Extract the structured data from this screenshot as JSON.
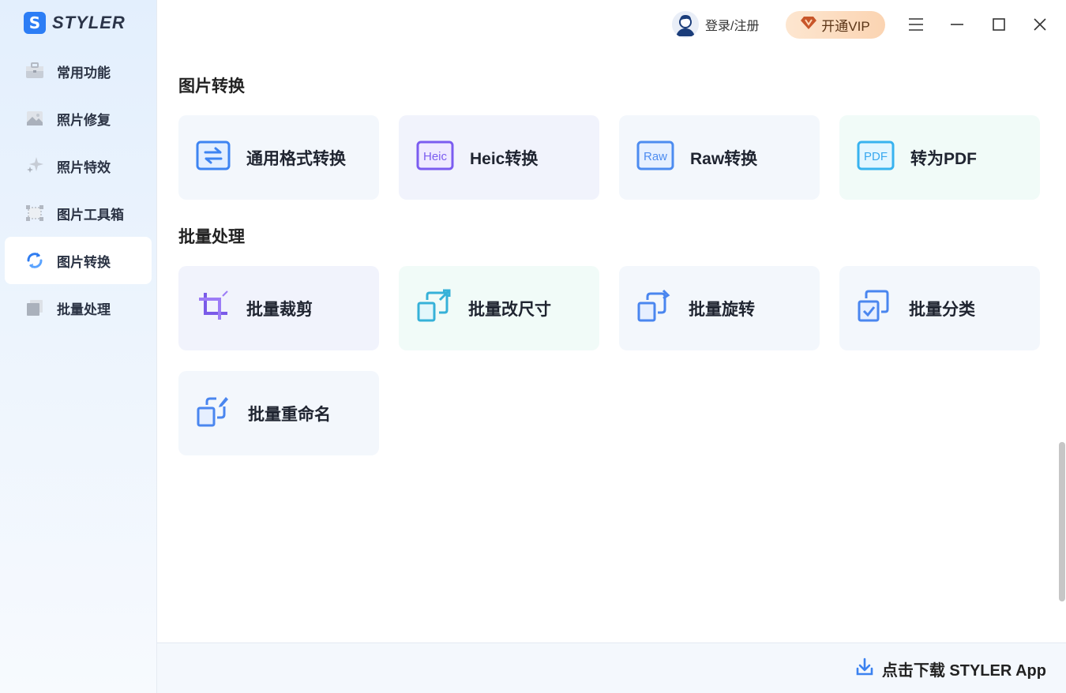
{
  "app": {
    "logo_letter": "S",
    "name": "STYLER"
  },
  "sidebar": {
    "items": [
      {
        "label": "常用功能",
        "icon": "toolbox-icon"
      },
      {
        "label": "照片修复",
        "icon": "photo-icon"
      },
      {
        "label": "照片特效",
        "icon": "sparkles-icon"
      },
      {
        "label": "图片工具箱",
        "icon": "frame-icon"
      },
      {
        "label": "图片转换",
        "icon": "convert-cycle-icon",
        "active": true
      },
      {
        "label": "批量处理",
        "icon": "stack-icon"
      }
    ]
  },
  "header": {
    "login_label": "登录/注册",
    "vip_label": "开通VIP",
    "vip_badge": "V"
  },
  "sections": {
    "convert": {
      "title": "图片转换",
      "cards": [
        {
          "label": "通用格式转换",
          "icon": "swap-arrows-icon"
        },
        {
          "label": "Heic转换",
          "icon": "heic-icon",
          "badge": "Heic"
        },
        {
          "label": "Raw转换",
          "icon": "raw-icon",
          "badge": "Raw"
        },
        {
          "label": "转为PDF",
          "icon": "pdf-icon",
          "badge": "PDF"
        }
      ]
    },
    "batch": {
      "title": "批量处理",
      "cards": [
        {
          "label": "批量裁剪",
          "icon": "crop-icon"
        },
        {
          "label": "批量改尺寸",
          "icon": "resize-icon"
        },
        {
          "label": "批量旋转",
          "icon": "rotate-icon"
        },
        {
          "label": "批量分类",
          "icon": "classify-icon"
        },
        {
          "label": "批量重命名",
          "icon": "rename-icon"
        }
      ]
    }
  },
  "footer": {
    "download_label": "点击下载 STYLER App"
  }
}
